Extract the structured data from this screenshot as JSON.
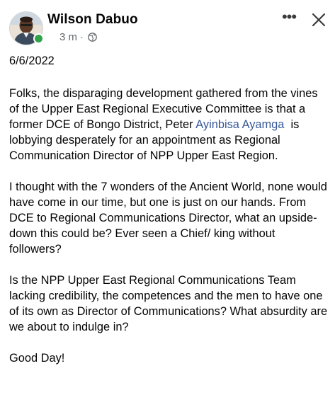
{
  "post": {
    "author": {
      "name": "Wilson Dabuo",
      "avatar_icon": "profile-photo",
      "online_status_color": "#31a24c"
    },
    "meta": {
      "time": "3 m",
      "separator": "·",
      "privacy_icon": "globe-icon"
    },
    "actions": {
      "more_icon": "more-horizontal-icon",
      "more_glyph": "•••",
      "close_icon": "close-icon"
    },
    "date": "6/6/2022",
    "paragraph_1": {
      "before_mention": "Folks, the disparaging development gathered from the vines of the Upper East Regional Executive Committee is that a former DCE of Bongo District, Peter ",
      "mention": "Ayinbisa Ayamga",
      "after_mention": "  is  lobbying desperately for an appointment as Regional Communication Director of NPP Upper East Region."
    },
    "paragraph_2": "I thought with the 7 wonders of the Ancient World, none would have come in our time, but one is just on our hands.  From DCE to Regional Communications Director, what an upside-down this could be? Ever seen a Chief/ king without followers?",
    "paragraph_3": "Is the NPP Upper East Regional Communications Team lacking  credibility, the competences and the  men to have one of its own as Director of Communications? What absurdity are we about to indulge in?",
    "closing": "Good Day!",
    "colors": {
      "text": "#050505",
      "secondary_text": "#65676b",
      "mention_link": "#385898"
    }
  }
}
